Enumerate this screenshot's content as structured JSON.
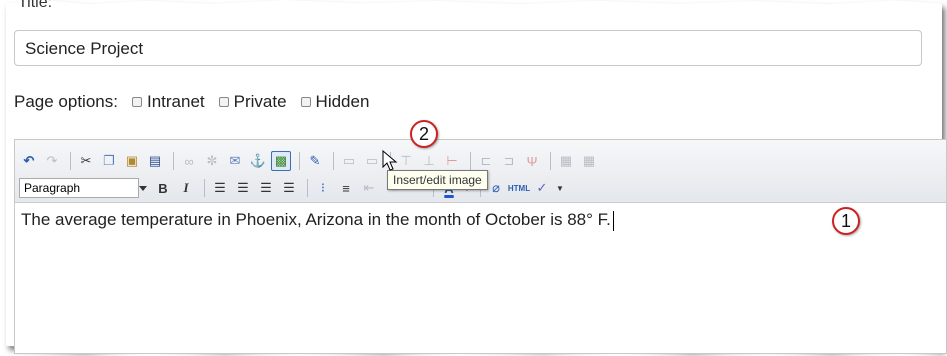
{
  "form": {
    "title_label": "Title:",
    "title_value": "Science Project",
    "page_options_label": "Page options:",
    "options": [
      {
        "label": "Intranet",
        "checked": false
      },
      {
        "label": "Private",
        "checked": false
      },
      {
        "label": "Hidden",
        "checked": false
      }
    ]
  },
  "editor": {
    "format_select": "Paragraph",
    "tooltip": "Insert/edit image",
    "content": "The average temperature in Phoenix, Arizona in the month of October is 88° F."
  },
  "callouts": [
    "1",
    "2"
  ],
  "colors": {
    "callout_border": "#cc2222",
    "active_button_border": "#3a6fb5"
  }
}
